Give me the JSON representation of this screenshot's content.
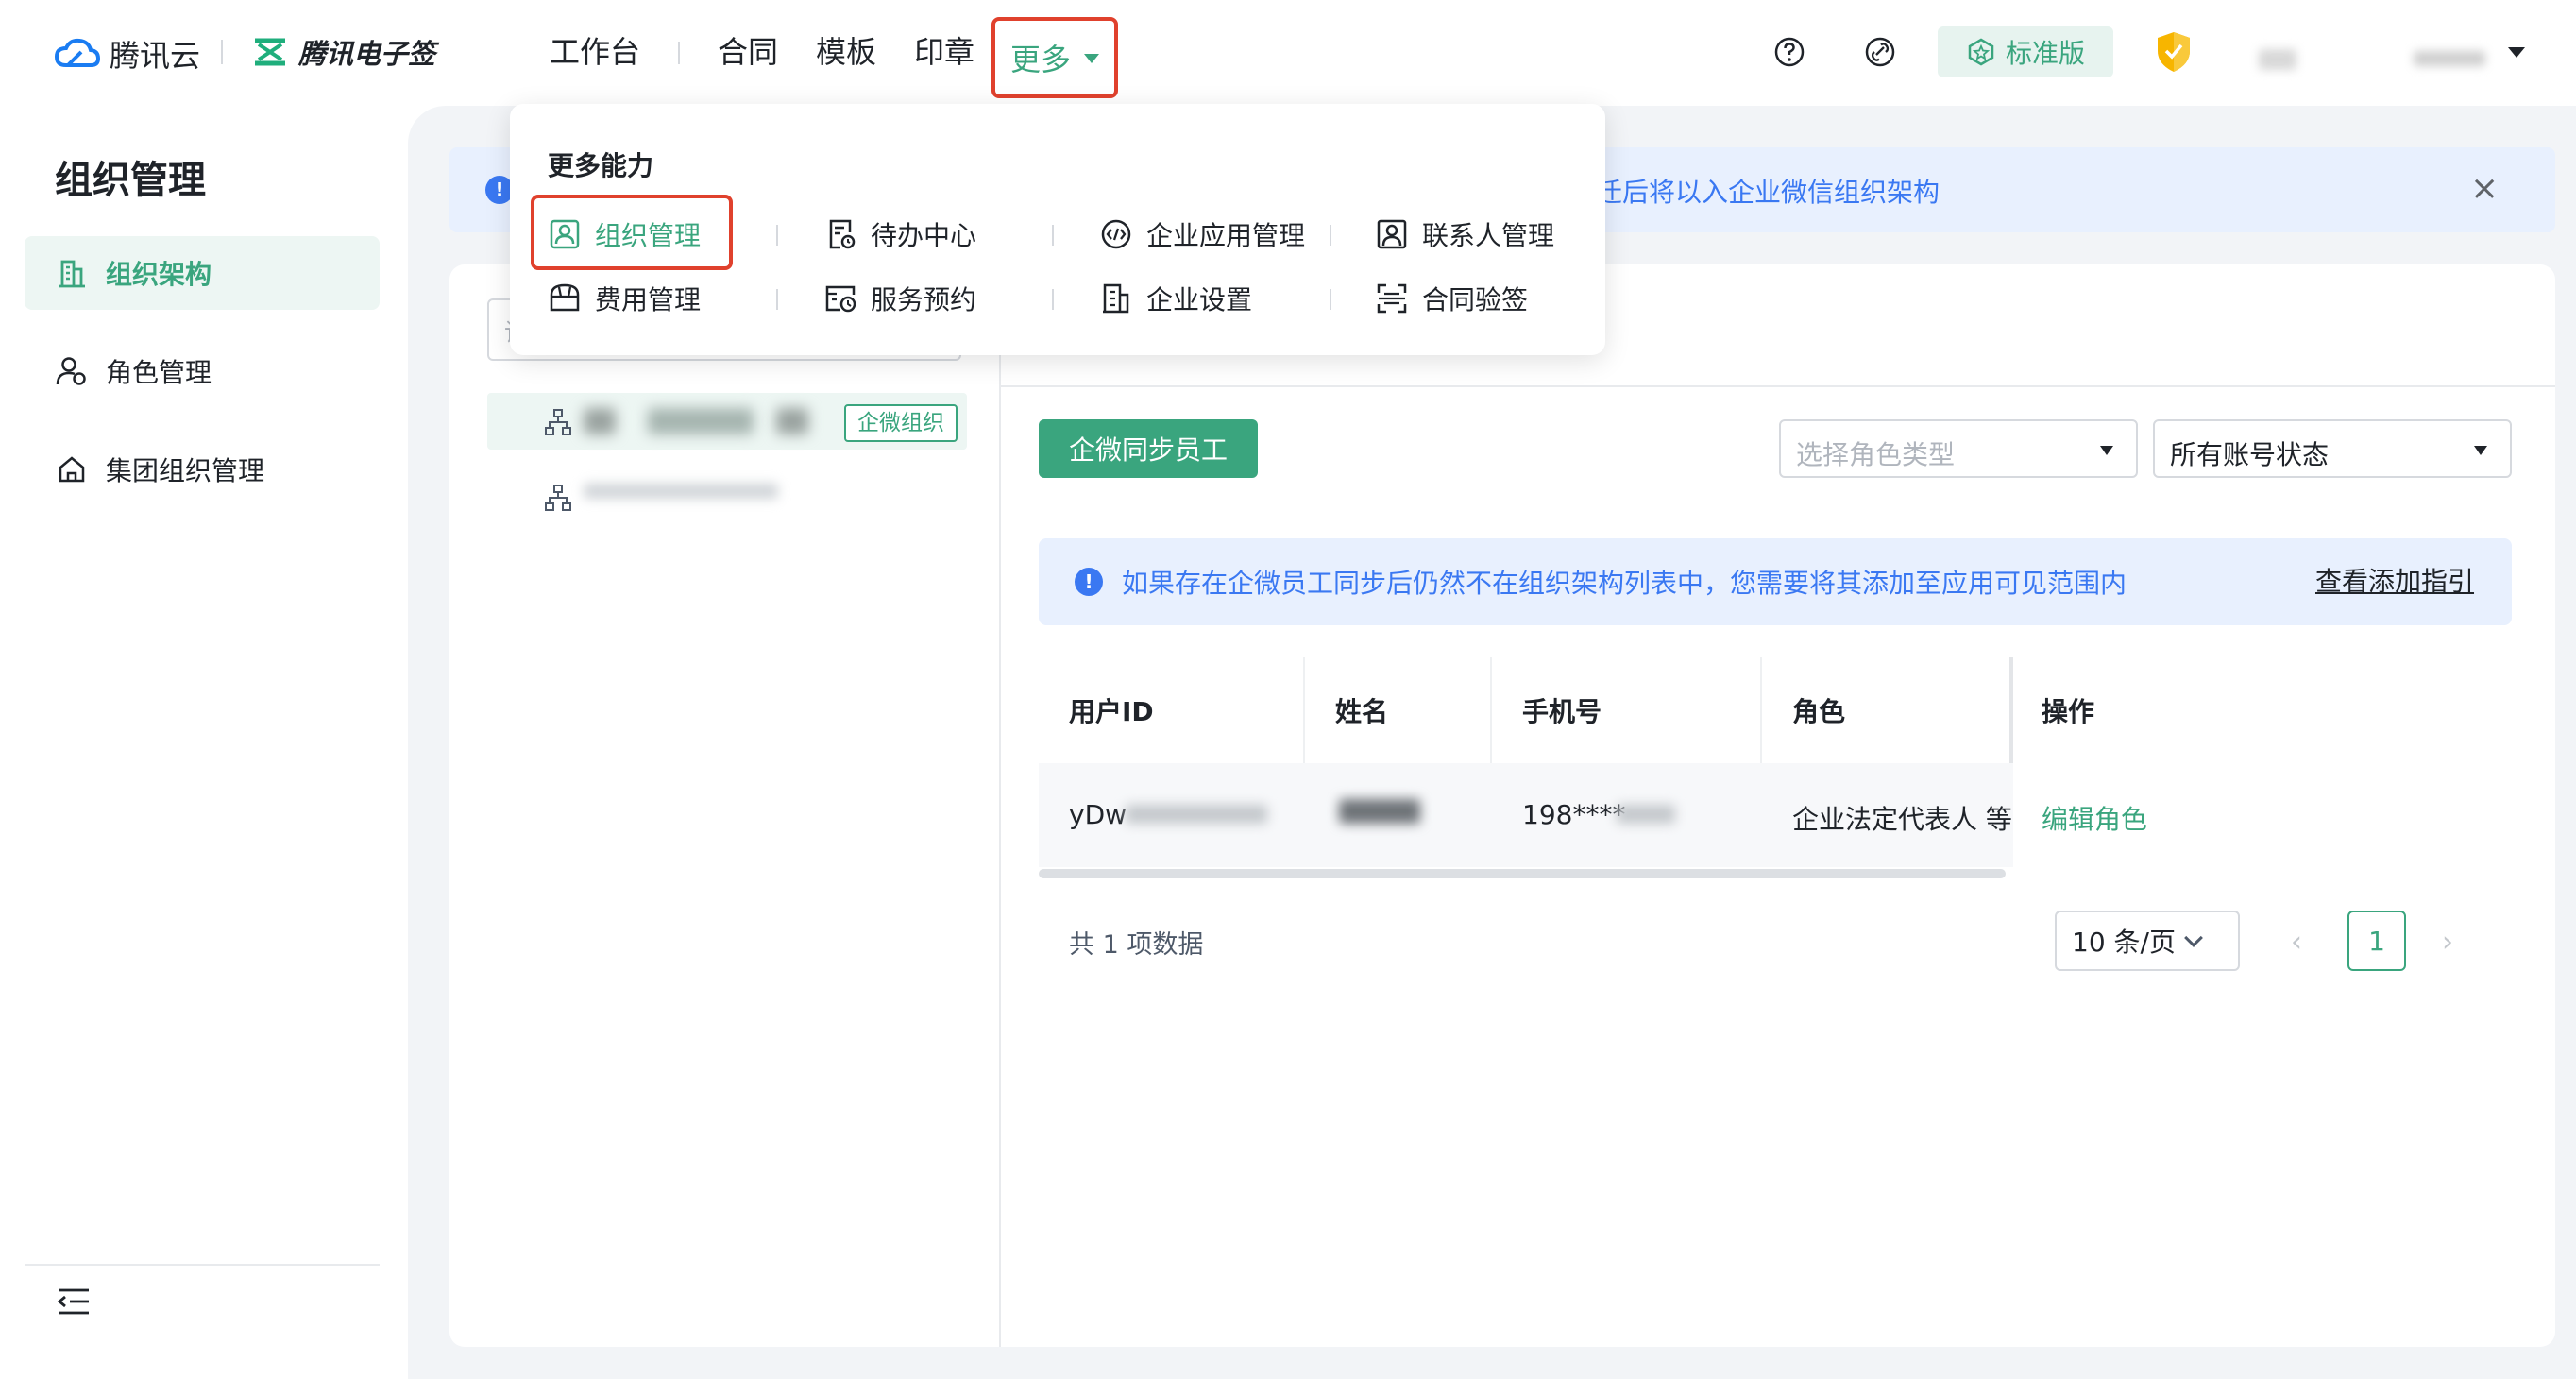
{
  "header": {
    "brand_cloud": "腾讯云",
    "brand_esign": "腾讯电子签",
    "nav": [
      "工作台",
      "合同",
      "模板",
      "印章"
    ],
    "nav_more": "更多",
    "edition": "标准版"
  },
  "sidebar": {
    "title": "组织管理",
    "items": [
      {
        "label": "组织架构",
        "icon": "org-chart-icon"
      },
      {
        "label": "角色管理",
        "icon": "user-role-icon"
      },
      {
        "label": "集团组织管理",
        "icon": "group-org-icon"
      }
    ]
  },
  "notice": {
    "text": "迁后将以入企业微信组织架构",
    "close": "×"
  },
  "tree": {
    "search_placeholder": "请",
    "wx_tag": "企微组织"
  },
  "toolbar": {
    "sync_button": "企微同步员工",
    "role_select_placeholder": "选择角色类型",
    "status_select_value": "所有账号状态"
  },
  "tip": {
    "text": "如果存在企微员工同步后仍然不在组织架构列表中，您需要将其添加至应用可见范围内",
    "link": "查看添加指引"
  },
  "table": {
    "columns": [
      "用户ID",
      "姓名",
      "手机号",
      "角色",
      "操作"
    ],
    "rows": [
      {
        "user_id": "yDw",
        "phone": "198****",
        "role": "企业法定代表人 等",
        "action": "编辑角色"
      }
    ]
  },
  "pagination": {
    "total": "共 1 项数据",
    "page_size": "10 条/页",
    "current_page": "1",
    "prev": "‹",
    "next": "›"
  },
  "menu": {
    "title": "更多能力",
    "items": [
      {
        "label": "组织管理",
        "icon": "org-manage-icon"
      },
      {
        "label": "待办中心",
        "icon": "todo-icon"
      },
      {
        "label": "企业应用管理",
        "icon": "app-code-icon"
      },
      {
        "label": "联系人管理",
        "icon": "contact-icon"
      },
      {
        "label": "费用管理",
        "icon": "fee-icon"
      },
      {
        "label": "服务预约",
        "icon": "service-booking-icon"
      },
      {
        "label": "企业设置",
        "icon": "enterprise-settings-icon"
      },
      {
        "label": "合同验签",
        "icon": "contract-verify-icon"
      }
    ]
  },
  "colors": {
    "brand_green": "#3aa57e",
    "info_blue": "#3a78f2",
    "highlight_red": "#e0412d"
  }
}
